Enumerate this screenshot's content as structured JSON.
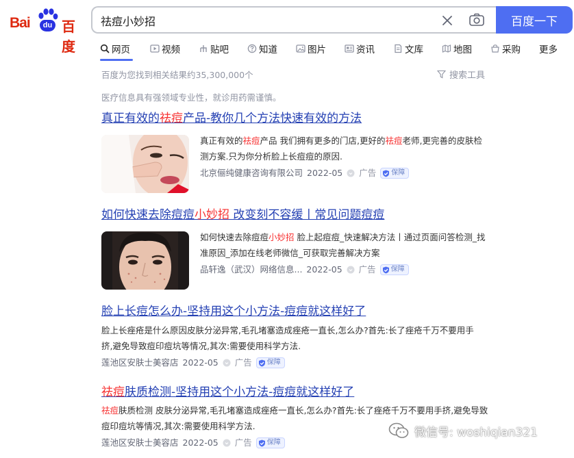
{
  "logo": {
    "bai": "Bai",
    "du": "du",
    "cn": "百度"
  },
  "search": {
    "query": "祛痘小妙招",
    "button_label": "百度一下"
  },
  "tabs": [
    {
      "label": "网页",
      "icon": "search-icon",
      "active": true
    },
    {
      "label": "视频",
      "icon": "video-icon"
    },
    {
      "label": "贴吧",
      "icon": "tieba-icon"
    },
    {
      "label": "知道",
      "icon": "zhidao-icon"
    },
    {
      "label": "图片",
      "icon": "image-icon"
    },
    {
      "label": "资讯",
      "icon": "news-icon"
    },
    {
      "label": "文库",
      "icon": "wenku-icon"
    },
    {
      "label": "地图",
      "icon": "map-icon"
    },
    {
      "label": "采购",
      "icon": "purchase-icon"
    },
    {
      "label": "更多"
    }
  ],
  "result_count": "百度为您找到相关结果约35,300,000个",
  "tools_label": "搜索工具",
  "medical_note": "医疗信息具有强领域专业性，就诊用药需谨慎。",
  "results": [
    {
      "title": [
        {
          "t": "真正有效的"
        },
        {
          "t": "祛痘",
          "hl": true
        },
        {
          "t": "产品-教你几个方法快速有效的方法"
        }
      ],
      "snippet": [
        {
          "t": "真正有效的"
        },
        {
          "t": "祛痘",
          "hl": true
        },
        {
          "t": "产品 我们拥有更多的门店,更好的"
        },
        {
          "t": "祛痘",
          "hl": true
        },
        {
          "t": "老师,更完善的皮肤检测方案.只为你分析脸上长痘痘的原因."
        }
      ],
      "source": "北京俪纯健康咨询有限公司",
      "date": "2022-05",
      "ad": "广告",
      "badge": "保障"
    },
    {
      "title": [
        {
          "t": "如何快速去除痘痘"
        },
        {
          "t": "小妙招",
          "hl": true
        },
        {
          "t": " 改变刻不容缓丨常见问题痘痘"
        }
      ],
      "snippet": [
        {
          "t": "如何快速去除痘痘"
        },
        {
          "t": "小妙招",
          "hl": true
        },
        {
          "t": " 脸上起痘痘_快速解决方法丨通过页面问答检测_找准原因_添加在线老师微信_可获取完善解决方案"
        }
      ],
      "source": "品轩逸（武汉）网络信息...",
      "date": "2022-05",
      "ad": "广告",
      "badge": "保障"
    },
    {
      "title": [
        {
          "t": "脸上长痘怎么办-坚持用这个小方法-痘痘就这样好了"
        }
      ],
      "snippet": [
        {
          "t": "脸上长痤疮是什么原因皮肤分泌异常,毛孔堵塞造成痤疮一直长,怎么办?首先:长了痤疮千万不要用手挤,避免导致痘印痘坑等情况,其次:需要使用科学方法."
        }
      ],
      "source": "莲池区安肤士美容店",
      "date": "2022-05",
      "ad": "广告",
      "badge": "保障"
    },
    {
      "title": [
        {
          "t": "祛痘",
          "hl": true
        },
        {
          "t": "肤质检测-坚持用这个小方法-痘痘就这样好了"
        }
      ],
      "snippet": [
        {
          "t": "祛痘",
          "hl": true
        },
        {
          "t": "肤质检测 皮肤分泌异常,毛孔堵塞造成痤疮一直长,怎么办?首先:长了痤疮千万不要用手挤,避免导致痘印痘坑等情况,其次:需要使用科学方法."
        }
      ],
      "source": "莲池区安肤士美容店",
      "date": "2022-05",
      "ad": "广告",
      "badge": "保障"
    }
  ],
  "watermark": "微信号: woshiqian321",
  "colors": {
    "brand_blue": "#4e6ef2",
    "link": "#2440b3",
    "highlight": "#f73131",
    "logo_red": "#de2910"
  }
}
